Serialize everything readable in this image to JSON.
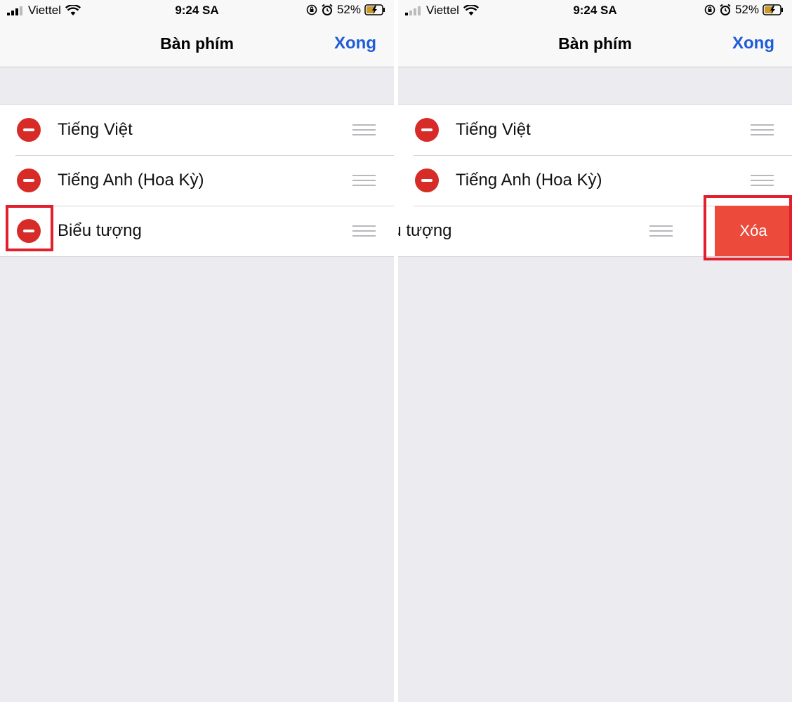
{
  "status": {
    "carrier": "Viettel",
    "time": "9:24 SA",
    "battery": "52%"
  },
  "nav": {
    "title": "Bàn phím",
    "done": "Xong"
  },
  "keyboards": [
    {
      "label": "Tiếng Việt"
    },
    {
      "label": "Tiếng Anh (Hoa Kỳ)"
    },
    {
      "label": "Biểu tượng"
    }
  ],
  "swiped_row": {
    "label_partial": "ểu tượng",
    "delete_label": "Xóa"
  },
  "colors": {
    "accent": "#1e5bd6",
    "destructive": "#d62b27",
    "delete_bg": "#ec4a3b",
    "highlight": "#e21f2d"
  }
}
